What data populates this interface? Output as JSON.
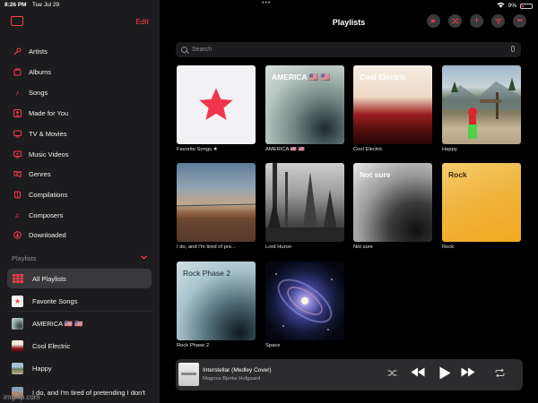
{
  "status": {
    "time": "8:26 PM",
    "date": "Tue Jul 29",
    "dots": "•••",
    "battery": "9%"
  },
  "sidebar": {
    "edit_label": "Edit",
    "library": [
      {
        "label": "Artists",
        "icon": "mic-icon"
      },
      {
        "label": "Albums",
        "icon": "album-icon"
      },
      {
        "label": "Songs",
        "icon": "note-icon"
      },
      {
        "label": "Made for You",
        "icon": "person-icon"
      },
      {
        "label": "TV & Movies",
        "icon": "tv-icon"
      },
      {
        "label": "Music Videos",
        "icon": "video-icon"
      },
      {
        "label": "Genres",
        "icon": "genres-icon"
      },
      {
        "label": "Compilations",
        "icon": "compilations-icon"
      },
      {
        "label": "Composers",
        "icon": "composers-icon"
      },
      {
        "label": "Downloaded",
        "icon": "download-icon"
      }
    ],
    "playlists_header": "Playlists",
    "playlists": [
      {
        "label": "All Playlists",
        "active": true
      },
      {
        "label": "Favorite Songs"
      },
      {
        "label": "AMERICA 🇺🇸 🇺🇸"
      },
      {
        "label": "Cool Electric"
      },
      {
        "label": "Happy"
      },
      {
        "label": "I do, and I'm tired of pretending I don't"
      }
    ]
  },
  "main": {
    "title": "Playlists",
    "search_placeholder": "Search",
    "tiles": [
      {
        "caption": "Favorite Songs ★",
        "tile_text": ""
      },
      {
        "caption": "AMERICA 🇺🇸 🇺🇸",
        "tile_text": "AMERICA 🇺🇸 🇺🇸"
      },
      {
        "caption": "Cool Electric",
        "tile_text": "Cool Electric"
      },
      {
        "caption": "Happy",
        "tile_text": ""
      },
      {
        "caption": "I do, and I'm tired of pre...",
        "tile_text": ""
      },
      {
        "caption": "Lord Huron",
        "tile_text": ""
      },
      {
        "caption": "Not sure",
        "tile_text": "Not sure"
      },
      {
        "caption": "Rock",
        "tile_text": "Rock"
      },
      {
        "caption": "Rock Phase 2",
        "tile_text": "Rock Phase 2"
      },
      {
        "caption": "Space",
        "tile_text": ""
      }
    ]
  },
  "player": {
    "song": "Interstellar (Medley Cover)",
    "artist": "Magnus Bjerke Hofgaard"
  },
  "watermark": "imgflip.com",
  "colors": {
    "accent": "#ff3b4e",
    "sidebar_bg": "#1c1c1e",
    "main_bg": "#000000"
  }
}
